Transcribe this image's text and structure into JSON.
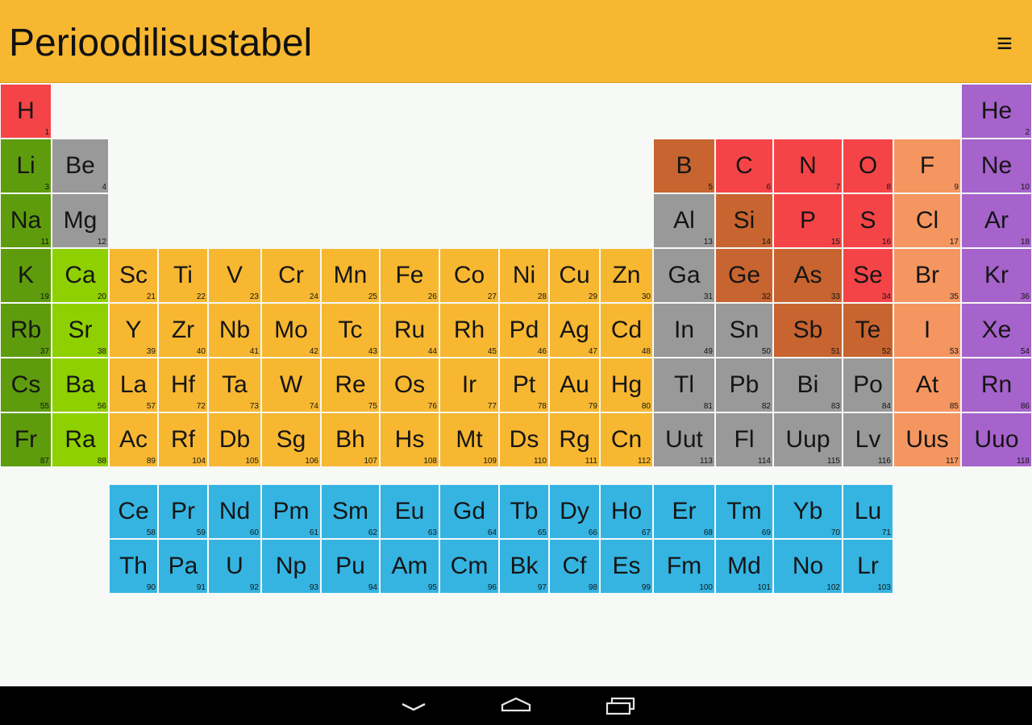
{
  "app_title": "Perioodilisustabel",
  "menu_icon": "menu-icon",
  "nav": {
    "back_icon": "back-chevron-icon",
    "home_icon": "home-icon",
    "recents_icon": "recents-icon"
  },
  "category_colors": {
    "h": "#f54447",
    "nonmetal": "#f54447",
    "alkali": "#5e9c0d",
    "alkaline": "#8fd000",
    "transition": "#f7b731",
    "post": "#999999",
    "metalloid": "#c86430",
    "halogen": "#f59660",
    "noble": "#a663cc",
    "lanth": "#35b4e2",
    "act": "#35b4e2"
  },
  "elements": [
    {
      "s": "H",
      "n": 1,
      "c": "h",
      "r": 1,
      "g": 1
    },
    {
      "s": "He",
      "n": 2,
      "c": "noble",
      "r": 1,
      "g": 18
    },
    {
      "s": "Li",
      "n": 3,
      "c": "alkali",
      "r": 2,
      "g": 1
    },
    {
      "s": "Be",
      "n": 4,
      "c": "post",
      "r": 2,
      "g": 2
    },
    {
      "s": "B",
      "n": 5,
      "c": "metalloid",
      "r": 2,
      "g": 13
    },
    {
      "s": "C",
      "n": 6,
      "c": "nonmetal",
      "r": 2,
      "g": 14
    },
    {
      "s": "N",
      "n": 7,
      "c": "nonmetal",
      "r": 2,
      "g": 15
    },
    {
      "s": "O",
      "n": 8,
      "c": "nonmetal",
      "r": 2,
      "g": 16
    },
    {
      "s": "F",
      "n": 9,
      "c": "halogen",
      "r": 2,
      "g": 17
    },
    {
      "s": "Ne",
      "n": 10,
      "c": "noble",
      "r": 2,
      "g": 18
    },
    {
      "s": "Na",
      "n": 11,
      "c": "alkali",
      "r": 3,
      "g": 1
    },
    {
      "s": "Mg",
      "n": 12,
      "c": "post",
      "r": 3,
      "g": 2
    },
    {
      "s": "Al",
      "n": 13,
      "c": "post",
      "r": 3,
      "g": 13
    },
    {
      "s": "Si",
      "n": 14,
      "c": "metalloid",
      "r": 3,
      "g": 14
    },
    {
      "s": "P",
      "n": 15,
      "c": "nonmetal",
      "r": 3,
      "g": 15
    },
    {
      "s": "S",
      "n": 16,
      "c": "nonmetal",
      "r": 3,
      "g": 16
    },
    {
      "s": "Cl",
      "n": 17,
      "c": "halogen",
      "r": 3,
      "g": 17
    },
    {
      "s": "Ar",
      "n": 18,
      "c": "noble",
      "r": 3,
      "g": 18
    },
    {
      "s": "K",
      "n": 19,
      "c": "alkali",
      "r": 4,
      "g": 1
    },
    {
      "s": "Ca",
      "n": 20,
      "c": "alkaline",
      "r": 4,
      "g": 2
    },
    {
      "s": "Sc",
      "n": 21,
      "c": "transition",
      "r": 4,
      "g": 3
    },
    {
      "s": "Ti",
      "n": 22,
      "c": "transition",
      "r": 4,
      "g": 4
    },
    {
      "s": "V",
      "n": 23,
      "c": "transition",
      "r": 4,
      "g": 5
    },
    {
      "s": "Cr",
      "n": 24,
      "c": "transition",
      "r": 4,
      "g": 6
    },
    {
      "s": "Mn",
      "n": 25,
      "c": "transition",
      "r": 4,
      "g": 7
    },
    {
      "s": "Fe",
      "n": 26,
      "c": "transition",
      "r": 4,
      "g": 8
    },
    {
      "s": "Co",
      "n": 27,
      "c": "transition",
      "r": 4,
      "g": 9
    },
    {
      "s": "Ni",
      "n": 28,
      "c": "transition",
      "r": 4,
      "g": 10
    },
    {
      "s": "Cu",
      "n": 29,
      "c": "transition",
      "r": 4,
      "g": 11
    },
    {
      "s": "Zn",
      "n": 30,
      "c": "transition",
      "r": 4,
      "g": 12
    },
    {
      "s": "Ga",
      "n": 31,
      "c": "post",
      "r": 4,
      "g": 13
    },
    {
      "s": "Ge",
      "n": 32,
      "c": "metalloid",
      "r": 4,
      "g": 14
    },
    {
      "s": "As",
      "n": 33,
      "c": "metalloid",
      "r": 4,
      "g": 15
    },
    {
      "s": "Se",
      "n": 34,
      "c": "nonmetal",
      "r": 4,
      "g": 16
    },
    {
      "s": "Br",
      "n": 35,
      "c": "halogen",
      "r": 4,
      "g": 17
    },
    {
      "s": "Kr",
      "n": 36,
      "c": "noble",
      "r": 4,
      "g": 18
    },
    {
      "s": "Rb",
      "n": 37,
      "c": "alkali",
      "r": 5,
      "g": 1
    },
    {
      "s": "Sr",
      "n": 38,
      "c": "alkaline",
      "r": 5,
      "g": 2
    },
    {
      "s": "Y",
      "n": 39,
      "c": "transition",
      "r": 5,
      "g": 3
    },
    {
      "s": "Zr",
      "n": 40,
      "c": "transition",
      "r": 5,
      "g": 4
    },
    {
      "s": "Nb",
      "n": 41,
      "c": "transition",
      "r": 5,
      "g": 5
    },
    {
      "s": "Mo",
      "n": 42,
      "c": "transition",
      "r": 5,
      "g": 6
    },
    {
      "s": "Tc",
      "n": 43,
      "c": "transition",
      "r": 5,
      "g": 7
    },
    {
      "s": "Ru",
      "n": 44,
      "c": "transition",
      "r": 5,
      "g": 8
    },
    {
      "s": "Rh",
      "n": 45,
      "c": "transition",
      "r": 5,
      "g": 9
    },
    {
      "s": "Pd",
      "n": 46,
      "c": "transition",
      "r": 5,
      "g": 10
    },
    {
      "s": "Ag",
      "n": 47,
      "c": "transition",
      "r": 5,
      "g": 11
    },
    {
      "s": "Cd",
      "n": 48,
      "c": "transition",
      "r": 5,
      "g": 12
    },
    {
      "s": "In",
      "n": 49,
      "c": "post",
      "r": 5,
      "g": 13
    },
    {
      "s": "Sn",
      "n": 50,
      "c": "post",
      "r": 5,
      "g": 14
    },
    {
      "s": "Sb",
      "n": 51,
      "c": "metalloid",
      "r": 5,
      "g": 15
    },
    {
      "s": "Te",
      "n": 52,
      "c": "metalloid",
      "r": 5,
      "g": 16
    },
    {
      "s": "I",
      "n": 53,
      "c": "halogen",
      "r": 5,
      "g": 17
    },
    {
      "s": "Xe",
      "n": 54,
      "c": "noble",
      "r": 5,
      "g": 18
    },
    {
      "s": "Cs",
      "n": 55,
      "c": "alkali",
      "r": 6,
      "g": 1
    },
    {
      "s": "Ba",
      "n": 56,
      "c": "alkaline",
      "r": 6,
      "g": 2
    },
    {
      "s": "La",
      "n": 57,
      "c": "transition",
      "r": 6,
      "g": 3
    },
    {
      "s": "Hf",
      "n": 72,
      "c": "transition",
      "r": 6,
      "g": 4
    },
    {
      "s": "Ta",
      "n": 73,
      "c": "transition",
      "r": 6,
      "g": 5
    },
    {
      "s": "W",
      "n": 74,
      "c": "transition",
      "r": 6,
      "g": 6
    },
    {
      "s": "Re",
      "n": 75,
      "c": "transition",
      "r": 6,
      "g": 7
    },
    {
      "s": "Os",
      "n": 76,
      "c": "transition",
      "r": 6,
      "g": 8
    },
    {
      "s": "Ir",
      "n": 77,
      "c": "transition",
      "r": 6,
      "g": 9
    },
    {
      "s": "Pt",
      "n": 78,
      "c": "transition",
      "r": 6,
      "g": 10
    },
    {
      "s": "Au",
      "n": 79,
      "c": "transition",
      "r": 6,
      "g": 11
    },
    {
      "s": "Hg",
      "n": 80,
      "c": "transition",
      "r": 6,
      "g": 12
    },
    {
      "s": "Tl",
      "n": 81,
      "c": "post",
      "r": 6,
      "g": 13
    },
    {
      "s": "Pb",
      "n": 82,
      "c": "post",
      "r": 6,
      "g": 14
    },
    {
      "s": "Bi",
      "n": 83,
      "c": "post",
      "r": 6,
      "g": 15
    },
    {
      "s": "Po",
      "n": 84,
      "c": "post",
      "r": 6,
      "g": 16
    },
    {
      "s": "At",
      "n": 85,
      "c": "halogen",
      "r": 6,
      "g": 17
    },
    {
      "s": "Rn",
      "n": 86,
      "c": "noble",
      "r": 6,
      "g": 18
    },
    {
      "s": "Fr",
      "n": 87,
      "c": "alkali",
      "r": 7,
      "g": 1
    },
    {
      "s": "Ra",
      "n": 88,
      "c": "alkaline",
      "r": 7,
      "g": 2
    },
    {
      "s": "Ac",
      "n": 89,
      "c": "transition",
      "r": 7,
      "g": 3
    },
    {
      "s": "Rf",
      "n": 104,
      "c": "transition",
      "r": 7,
      "g": 4
    },
    {
      "s": "Db",
      "n": 105,
      "c": "transition",
      "r": 7,
      "g": 5
    },
    {
      "s": "Sg",
      "n": 106,
      "c": "transition",
      "r": 7,
      "g": 6
    },
    {
      "s": "Bh",
      "n": 107,
      "c": "transition",
      "r": 7,
      "g": 7
    },
    {
      "s": "Hs",
      "n": 108,
      "c": "transition",
      "r": 7,
      "g": 8
    },
    {
      "s": "Mt",
      "n": 109,
      "c": "transition",
      "r": 7,
      "g": 9
    },
    {
      "s": "Ds",
      "n": 110,
      "c": "transition",
      "r": 7,
      "g": 10
    },
    {
      "s": "Rg",
      "n": 111,
      "c": "transition",
      "r": 7,
      "g": 11
    },
    {
      "s": "Cn",
      "n": 112,
      "c": "transition",
      "r": 7,
      "g": 12
    },
    {
      "s": "Uut",
      "n": 113,
      "c": "post",
      "r": 7,
      "g": 13
    },
    {
      "s": "Fl",
      "n": 114,
      "c": "post",
      "r": 7,
      "g": 14
    },
    {
      "s": "Uup",
      "n": 115,
      "c": "post",
      "r": 7,
      "g": 15
    },
    {
      "s": "Lv",
      "n": 116,
      "c": "post",
      "r": 7,
      "g": 16
    },
    {
      "s": "Uus",
      "n": 117,
      "c": "halogen",
      "r": 7,
      "g": 17
    },
    {
      "s": "Uuo",
      "n": 118,
      "c": "noble",
      "r": 7,
      "g": 18
    },
    {
      "s": "Ce",
      "n": 58,
      "c": "lanth",
      "r": 9,
      "g": 3
    },
    {
      "s": "Pr",
      "n": 59,
      "c": "lanth",
      "r": 9,
      "g": 4
    },
    {
      "s": "Nd",
      "n": 60,
      "c": "lanth",
      "r": 9,
      "g": 5
    },
    {
      "s": "Pm",
      "n": 61,
      "c": "lanth",
      "r": 9,
      "g": 6
    },
    {
      "s": "Sm",
      "n": 62,
      "c": "lanth",
      "r": 9,
      "g": 7
    },
    {
      "s": "Eu",
      "n": 63,
      "c": "lanth",
      "r": 9,
      "g": 8
    },
    {
      "s": "Gd",
      "n": 64,
      "c": "lanth",
      "r": 9,
      "g": 9
    },
    {
      "s": "Tb",
      "n": 65,
      "c": "lanth",
      "r": 9,
      "g": 10
    },
    {
      "s": "Dy",
      "n": 66,
      "c": "lanth",
      "r": 9,
      "g": 11
    },
    {
      "s": "Ho",
      "n": 67,
      "c": "lanth",
      "r": 9,
      "g": 12
    },
    {
      "s": "Er",
      "n": 68,
      "c": "lanth",
      "r": 9,
      "g": 13
    },
    {
      "s": "Tm",
      "n": 69,
      "c": "lanth",
      "r": 9,
      "g": 14
    },
    {
      "s": "Yb",
      "n": 70,
      "c": "lanth",
      "r": 9,
      "g": 15
    },
    {
      "s": "Lu",
      "n": 71,
      "c": "lanth",
      "r": 9,
      "g": 16
    },
    {
      "s": "Th",
      "n": 90,
      "c": "act",
      "r": 10,
      "g": 3
    },
    {
      "s": "Pa",
      "n": 91,
      "c": "act",
      "r": 10,
      "g": 4
    },
    {
      "s": "U",
      "n": 92,
      "c": "act",
      "r": 10,
      "g": 5
    },
    {
      "s": "Np",
      "n": 93,
      "c": "act",
      "r": 10,
      "g": 6
    },
    {
      "s": "Pu",
      "n": 94,
      "c": "act",
      "r": 10,
      "g": 7
    },
    {
      "s": "Am",
      "n": 95,
      "c": "act",
      "r": 10,
      "g": 8
    },
    {
      "s": "Cm",
      "n": 96,
      "c": "act",
      "r": 10,
      "g": 9
    },
    {
      "s": "Bk",
      "n": 97,
      "c": "act",
      "r": 10,
      "g": 10
    },
    {
      "s": "Cf",
      "n": 98,
      "c": "act",
      "r": 10,
      "g": 11
    },
    {
      "s": "Es",
      "n": 99,
      "c": "act",
      "r": 10,
      "g": 12
    },
    {
      "s": "Fm",
      "n": 100,
      "c": "act",
      "r": 10,
      "g": 13
    },
    {
      "s": "Md",
      "n": 101,
      "c": "act",
      "r": 10,
      "g": 14
    },
    {
      "s": "No",
      "n": 102,
      "c": "act",
      "r": 10,
      "g": 15
    },
    {
      "s": "Lr",
      "n": 103,
      "c": "act",
      "r": 10,
      "g": 16
    }
  ]
}
